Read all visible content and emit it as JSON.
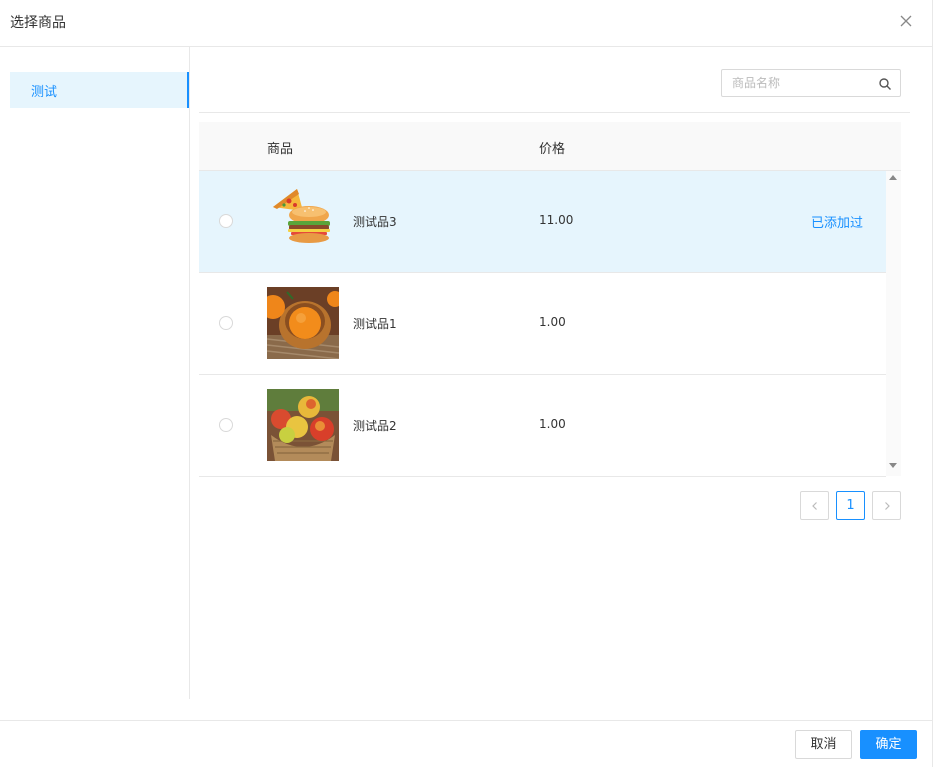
{
  "dialog": {
    "title": "选择商品"
  },
  "sidebar": {
    "items": [
      {
        "label": "测试"
      }
    ]
  },
  "search": {
    "placeholder": "商品名称",
    "value": ""
  },
  "table": {
    "columns": {
      "product": "商品",
      "price": "价格"
    },
    "rows": [
      {
        "name": "测试品3",
        "price": "11.00",
        "status": "已添加过",
        "image": "pizza-burger",
        "selected": true
      },
      {
        "name": "测试品1",
        "price": "1.00",
        "status": "",
        "image": "orange-bowl",
        "selected": false
      },
      {
        "name": "测试品2",
        "price": "1.00",
        "status": "",
        "image": "apple-basket",
        "selected": false
      }
    ]
  },
  "pagination": {
    "current_page": "1"
  },
  "footer": {
    "cancel_label": "取消",
    "confirm_label": "确定"
  },
  "colors": {
    "primary": "#1890ff",
    "selected_row": "#e6f5fd",
    "border": "#e8e8e8"
  }
}
